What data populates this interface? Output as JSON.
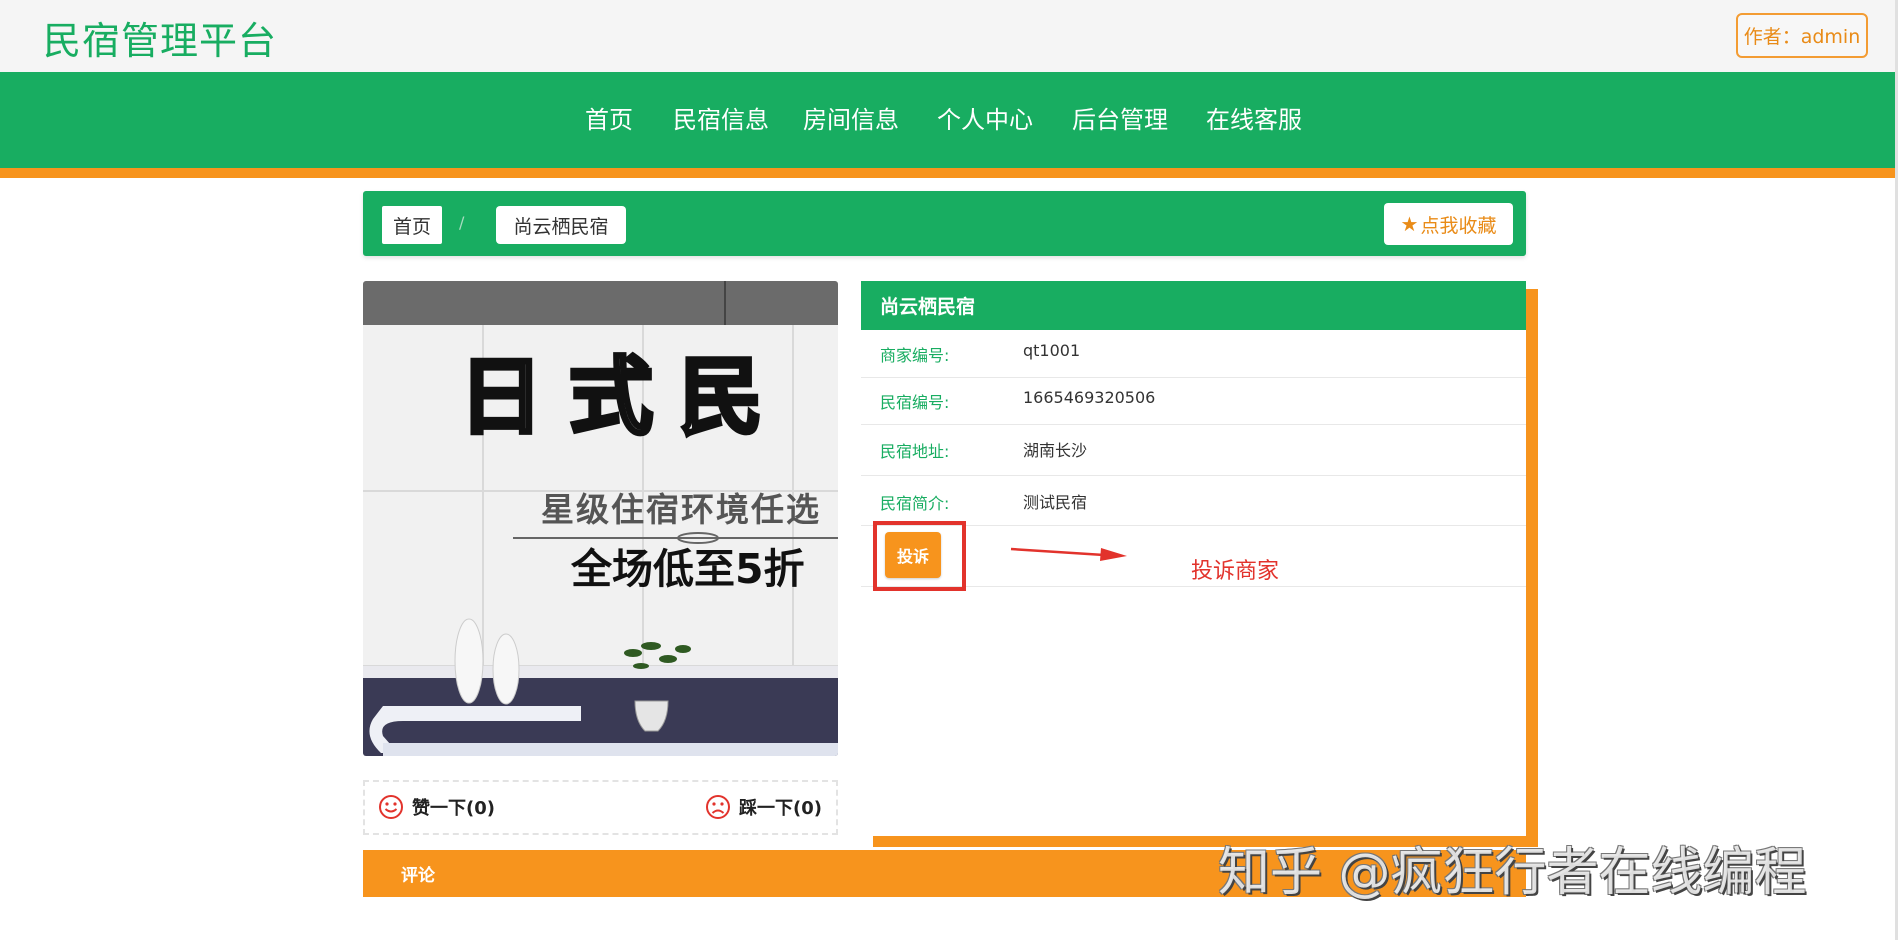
{
  "header": {
    "logo": "民宿管理平台",
    "author_label": "作者：admin"
  },
  "nav": {
    "items": [
      "首页",
      "民宿信息",
      "房间信息",
      "个人中心",
      "后台管理",
      "在线客服"
    ]
  },
  "breadcrumb": {
    "home": "首页",
    "separator": "/",
    "current": "尚云栖民宿"
  },
  "favorite_button": "点我收藏",
  "photo": {
    "headline": "日式民",
    "subline": "星级住宿环境任选",
    "promo": "全场低至5折"
  },
  "votes": {
    "like_label": "赞一下(0)",
    "dislike_label": "踩一下(0)"
  },
  "info": {
    "title": "尚云栖民宿",
    "rows": [
      {
        "label": "商家编号:",
        "value": "qt1001"
      },
      {
        "label": "民宿编号:",
        "value": "1665469320506"
      },
      {
        "label": "民宿地址:",
        "value": "湖南长沙"
      },
      {
        "label": "民宿简介:",
        "value": "测试民宿"
      }
    ],
    "complain_button": "投诉",
    "annotation": "投诉商家"
  },
  "comment_section": {
    "title": "评论"
  },
  "watermark": "知乎 @疯狂行者在线编程",
  "colors": {
    "green": "#18ad61",
    "orange": "#f7941d",
    "red": "#e2332c"
  }
}
